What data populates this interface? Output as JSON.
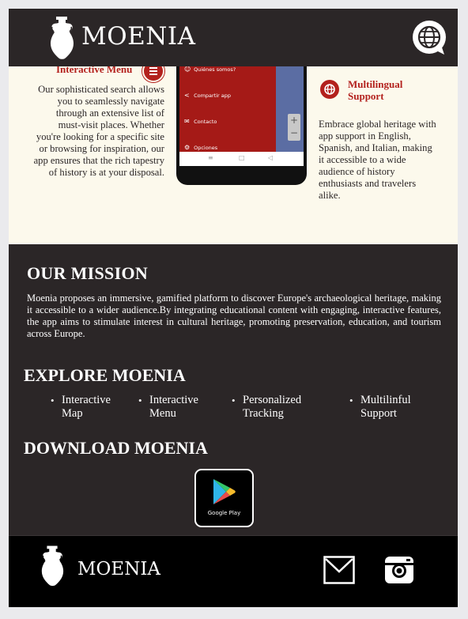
{
  "header": {
    "logo_text": "MOENIA"
  },
  "features": {
    "menu": {
      "title": "Interactive Menu",
      "text": "Our sophisticated search allows you to seamlessly navigate through an extensive list of must-visit places. Whether you're looking for a specific site or browsing for inspiration, our app ensures that the rich tapestry of history is at your disposal."
    },
    "phone": {
      "menu_items": [
        "Quiénes somos?",
        "Compartir app",
        "Contacto",
        "Opciones"
      ]
    },
    "multilingual": {
      "title": "Multilingual Support",
      "text": "Embrace global heritage with app support in English, Spanish, and Italian, making it accessible to a wide audience of history enthusiasts and travelers alike."
    }
  },
  "mission": {
    "title": "OUR MISSION",
    "text": "Moenia proposes an immersive, gamified platform to discover Europe's archaeological heritage, making it accessible to a wider audience.By integrating educational content with engaging, interactive features, the app aims to stimulate interest in cultural heritage, promoting preservation, education, and tourism across Europe."
  },
  "explore": {
    "title": "EXPLORE MOENIA",
    "items": [
      "Interactive Map",
      "Interactive Menu",
      "Personalized Tracking",
      "Multilinful Support"
    ]
  },
  "download": {
    "title": "DOWNLOAD MOENIA",
    "store_label": "Google Play"
  },
  "footer": {
    "logo_text": "MOENIA"
  },
  "colors": {
    "dark": "#2b2627",
    "accent_red": "#b3211d",
    "cream": "#fcf9ec",
    "footer": "#000000"
  },
  "icons": [
    "amphora-logo",
    "globe-icon",
    "list-icon",
    "translate-icon",
    "google-play-icon",
    "mail-icon",
    "instagram-icon"
  ]
}
